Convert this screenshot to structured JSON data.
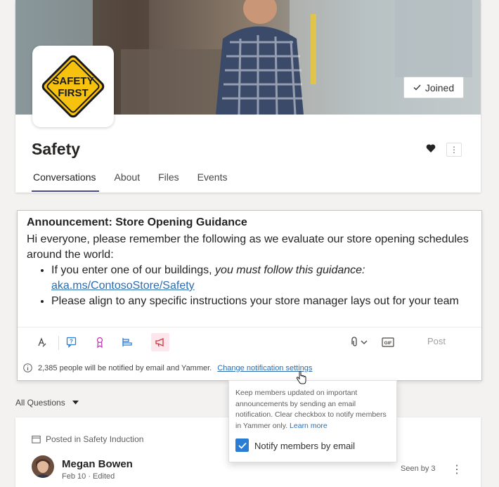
{
  "group": {
    "name": "Safety",
    "logo_text_line1": "SAFETY",
    "logo_text_line2": "FIRST",
    "joined_label": "Joined",
    "tabs": [
      {
        "label": "Conversations",
        "active": true
      },
      {
        "label": "About",
        "active": false
      },
      {
        "label": "Files",
        "active": false
      },
      {
        "label": "Events",
        "active": false
      }
    ]
  },
  "announcement": {
    "title": "Announcement: Store Opening Guidance",
    "intro": "Hi everyone, please remember the following as we evaluate our store opening schedules around the world:",
    "bullet1_plain": "If you enter one of our buildings, ",
    "bullet1_emph": "you must follow this guidance:",
    "bullet1_link": "aka.ms/ContosoStore/Safety",
    "bullet2": "Please align to any specific instructions your store manager lays out for your team",
    "post_label": "Post",
    "notify_text": "2,385 people will be notified by email and Yammer.",
    "notify_link": "Change notification settings"
  },
  "tooltip": {
    "text": "Keep members updated on important announcements by sending an email notification.  Clear checkbox to notify members in Yammer only.",
    "learn_more": "Learn more",
    "checkbox_label": "Notify members by email",
    "checked": true
  },
  "filter": {
    "label": "All Questions"
  },
  "post": {
    "posted_in": "Posted in Safety Induction",
    "author": "Megan Bowen",
    "date": "Feb 10",
    "edited": "Edited",
    "seen_by": "Seen by 3"
  },
  "colors": {
    "accent": "#4a4a8a",
    "link": "#2b6cb0",
    "checkbox": "#2b7cd3",
    "safety_yellow": "#f6c20d"
  }
}
